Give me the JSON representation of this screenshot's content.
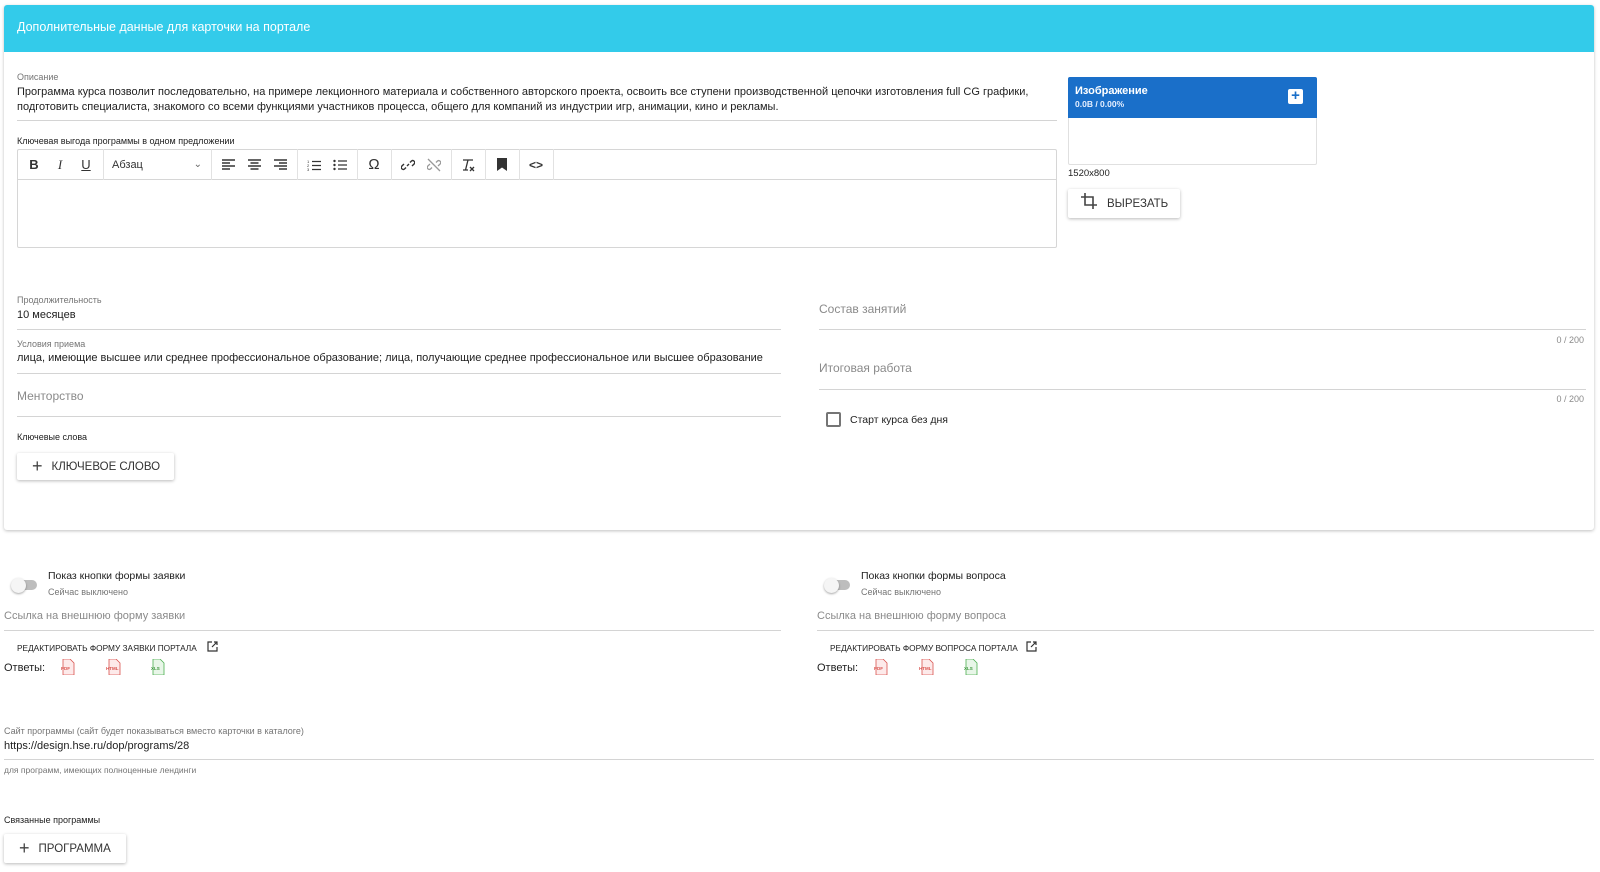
{
  "card": {
    "title": "Дополнительные данные для карточки на портале",
    "description_label": "Описание",
    "description_line1": "Программа курса позволит последовательно, на примере лекционного материала и собственного авторского проекта, освоить все ступени производственной цепочки изготовления full CG графики,",
    "description_line2": "подготовить специалиста, знакомого со всеми функциями участников процесса, общего для компаний из индустрии игр, анимации, кино и рекламы.",
    "key_benefit_label": "Ключевая выгода программы в одном предложении",
    "editor": {
      "bold": "B",
      "italic": "I",
      "underline": "U",
      "block_format": "Абзац",
      "omega": "Ω",
      "code": "<>"
    },
    "image": {
      "title": "Изображение",
      "size_info": "0.0B / 0.00%",
      "dimensions": "1520x800",
      "crop_label": "Вырезать"
    },
    "duration_label": "Продолжительность",
    "duration_value": "10 месяцев",
    "admission_label": "Условия приема",
    "admission_value": "лица, имеющие высшее или среднее профессиональное образование; лица,  получающие  среднее профессиональное или высшее образование",
    "mentoring_placeholder": "Менторство",
    "keywords_label": "Ключевые слова",
    "keyword_button": "Ключевое слово",
    "lessons_placeholder": "Состав занятий",
    "lessons_counter": "0 / 200",
    "final_work_placeholder": "Итоговая работа",
    "final_work_counter": "0 / 200",
    "start_without_day_label": "Старт курса без дня"
  },
  "application_form": {
    "toggle_label": "Показ кнопки формы заявки",
    "toggle_status": "Сейчас выключено",
    "link_placeholder": "Ссылка на внешнюю форму заявки",
    "edit_link": "Редактировать форму заявки портала",
    "answers_label": "Ответы:"
  },
  "question_form": {
    "toggle_label": "Показ кнопки формы вопроса",
    "toggle_status": "Сейчас выключено",
    "link_placeholder": "Ссылка на внешнюю форму вопроса",
    "edit_link": "Редактировать форму вопроса портала",
    "answers_label": "Ответы:"
  },
  "file_types": [
    "PDF",
    "HTML",
    "XLS"
  ],
  "program_site": {
    "label": "Сайт программы (сайт будет показываться вместо карточки в каталоге)",
    "value": "https://design.hse.ru/dop/programs/28",
    "hint": "для программ, имеющих полноценные лендинги"
  },
  "related": {
    "label": "Связанные программы",
    "button": "Программа"
  },
  "colors": {
    "header": "#33cbea",
    "image_header": "#1a6fc9"
  }
}
